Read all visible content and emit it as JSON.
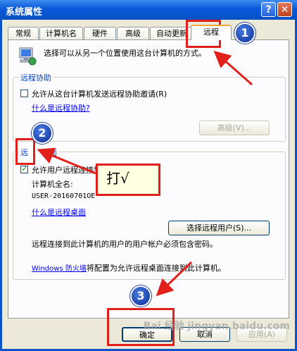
{
  "window": {
    "title": "系统属性",
    "help_glyph": "?",
    "close_glyph": "✕"
  },
  "tabs": [
    "常规",
    "计算机名",
    "硬件",
    "高级",
    "自动更新",
    "远程"
  ],
  "intro_text": "选择可以从另一个位置使用这台计算机的方式。",
  "remote_assistance": {
    "label": "远程协助",
    "checkbox_label": "允许从这台计算机发送远程协助邀请(R)",
    "link": "什么是远程协助?",
    "advanced_button": "高级(V)..."
  },
  "remote_desktop": {
    "label": "远",
    "label_suffix": "面",
    "checkbox_label": "允许用户远程连接到此计算机(C)",
    "computer_name_label": "计算机全名:",
    "computer_name_value": "USER-20160701OE",
    "link": "什么是远程桌面",
    "select_users_button": "选择远程用户(S)...",
    "password_note": "远程连接到此计算机的用户的用户帐户必须包含密码。",
    "firewall_link": "Windows 防火墙",
    "firewall_text": "将配置为允许远程桌面连接到此计算机。"
  },
  "buttons": {
    "ok": "确定",
    "cancel": "取消",
    "apply": "应用(A)"
  },
  "annotations": {
    "badge1": "1",
    "badge2": "2",
    "badge3": "3",
    "note": "打√"
  },
  "watermark": "Bai 经验 jingyan.baidu.com"
}
